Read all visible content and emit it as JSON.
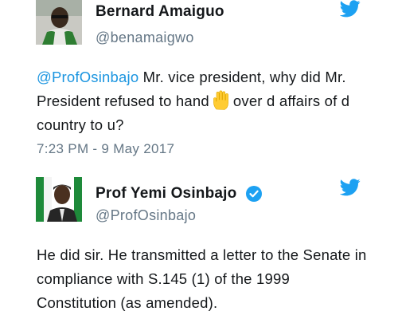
{
  "tweets": [
    {
      "name": "Bernard  Amaiguo",
      "handle": "@benamaigwo",
      "mention": "@ProfOsinbajo",
      "text_before_emoji": " Mr.  vice president, why did Mr.  President refused to hand",
      "emoji": "raised-hand-icon",
      "text_after_emoji": "over d affairs of d country to u?",
      "timestamp": "7:23  PM - 9 May 2017"
    },
    {
      "name": "Prof Yemi Osinbajo",
      "handle": "@ProfOsinbajo",
      "verified": true,
      "text": "He did sir.  He transmitted a letter to the Senate in compliance with S.145 (1) of the 1999 Constitution (as amended)."
    }
  ],
  "colors": {
    "twitter_blue": "#1da1f2",
    "link": "#1b95e0",
    "secondary_text": "#657786",
    "emoji_yellow": "#ffcc33"
  }
}
